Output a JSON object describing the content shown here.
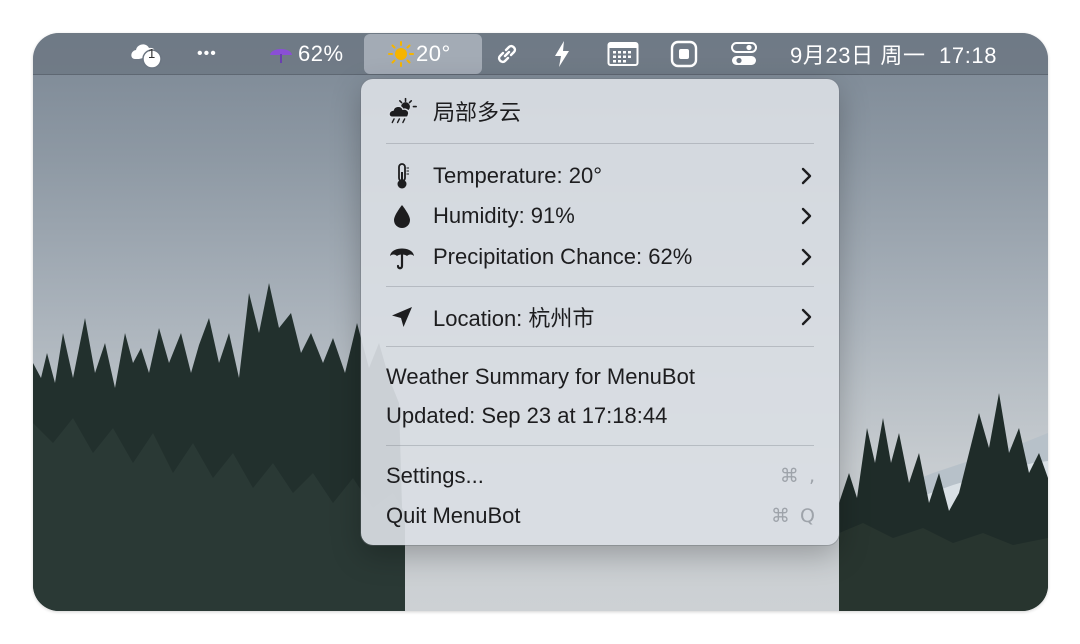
{
  "menubar": {
    "cloud_badge": "1",
    "more_glyph": "•••",
    "precip_text": "62%",
    "temp_text": "20°",
    "datetime": "9月23日 周一  17:18"
  },
  "menu": {
    "condition": "局部多云",
    "temperature": "Temperature: 20°",
    "humidity": "Humidity: 91%",
    "precipitation": "Precipitation Chance: 62%",
    "location": "Location: 杭州市",
    "summary": "Weather Summary for MenuBot",
    "updated": "Updated: Sep 23 at 17:18:44",
    "settings": "Settings...",
    "settings_shortcut": "⌘ ,",
    "quit": "Quit MenuBot",
    "quit_shortcut": "⌘ Q"
  },
  "colors": {
    "menu_bg": "#dadee4",
    "sun": "#f5b400",
    "umbrella": "#8a4fd6"
  },
  "icons": [
    "cloud-badge-icon",
    "more-icon",
    "umbrella-icon",
    "sun-icon",
    "link-icon",
    "bolt-icon",
    "calendar-grid-icon",
    "stop-square-icon",
    "toggle-icon",
    "partly-cloudy-icon",
    "thermometer-icon",
    "drop-icon",
    "umbrella-icon",
    "location-arrow-icon",
    "chevron-right-icon"
  ]
}
